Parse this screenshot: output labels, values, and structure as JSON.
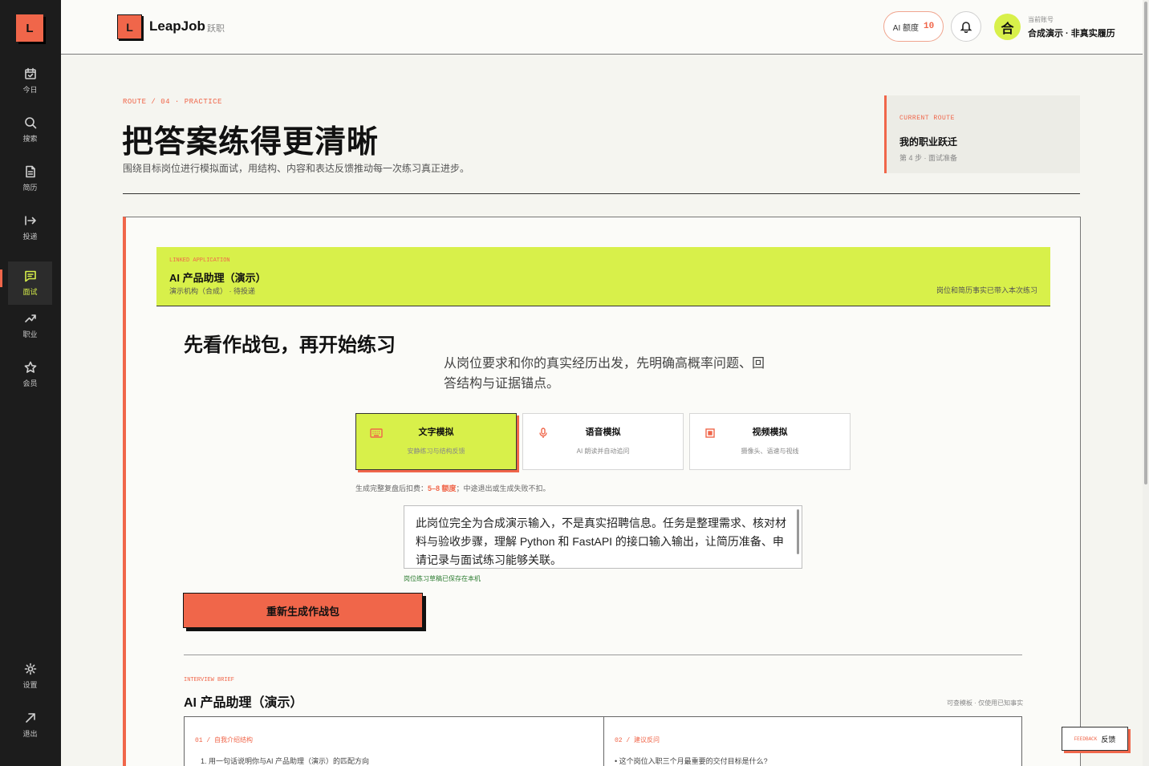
{
  "sidebar": {
    "logo": "L",
    "items": [
      {
        "label": "今日",
        "icon": "calendar-check-icon"
      },
      {
        "label": "搜索",
        "icon": "search-icon"
      },
      {
        "label": "简历",
        "icon": "document-icon"
      },
      {
        "label": "投递",
        "icon": "arrow-right-icon"
      },
      {
        "label": "面试",
        "icon": "chat-icon",
        "active": true
      },
      {
        "label": "职业",
        "icon": "trend-up-icon"
      },
      {
        "label": "会员",
        "icon": "star-icon"
      },
      {
        "label": "设置",
        "icon": "gear-icon"
      },
      {
        "label": "退出",
        "icon": "exit-arrow-icon"
      }
    ]
  },
  "topbar": {
    "brand_logo": "L",
    "brand_name": "LeapJob",
    "brand_tag": "跃职",
    "ai_quota_label": "AI 额度",
    "ai_quota_value": "10",
    "avatar_char": "合",
    "account_label": "当前账号",
    "account_name": "合成演示 · 非真实履历"
  },
  "header": {
    "route": "ROUTE / 04 · PRACTICE",
    "title": "把答案练得更清晰",
    "subtitle": "围绕目标岗位进行模拟面试，用结构、内容和表达反馈推动每一次练习真正进步。",
    "route_card": {
      "label": "CURRENT ROUTE",
      "title": "我的职业跃迁",
      "step": "第 4 步 · 面试准备"
    }
  },
  "linked": {
    "label": "LINKED APPLICATION",
    "title": "AI 产品助理（演示）",
    "subtitle": "演示机构（合成） · 待投递",
    "note": "岗位和简历事实已带入本次练习"
  },
  "prep": {
    "title": "先看作战包，再开始练习",
    "desc": "从岗位要求和你的真实经历出发，先明确高概率问题、回答结构与证据锚点。",
    "modes": [
      {
        "name": "文字模拟",
        "desc": "安静练习与结构反馈",
        "icon": "keyboard-icon",
        "active": true
      },
      {
        "name": "语音模拟",
        "desc": "AI 朗读并自动追问",
        "icon": "microphone-icon",
        "active": false
      },
      {
        "name": "视频模拟",
        "desc": "摄像头、语速与视线",
        "icon": "camera-icon",
        "active": false
      }
    ],
    "cost_prefix": "生成完整复盘后扣费：",
    "cost_value": "5–8 额度",
    "cost_suffix": "；中途退出或生成失败不扣。",
    "jd_text": "此岗位完全为合成演示输入，不是真实招聘信息。任务是整理需求、核对材料与验收步骤，理解 Python 和 FastAPI 的接口输入输出，让简历准备、申请记录与面试练习能够关联。",
    "jd_saved": "岗位练习草稿已保存在本机",
    "regen_button": "重新生成作战包"
  },
  "brief": {
    "label": "INTERVIEW BRIEF",
    "title": "AI 产品助理（演示）",
    "note": "可查模板 · 仅使用已知事实",
    "col1_head": "01 / 自我介绍结构",
    "col1_item": "1. 用一句话说明你与AI 产品助理（演示）的匹配方向",
    "col2_head": "02 / 建议反问",
    "col2_item": "•  这个岗位入职三个月最重要的交付目标是什么?"
  },
  "feedback": {
    "en": "FEEDBACK",
    "zh": "反馈"
  },
  "colors": {
    "accent": "#f0664a",
    "lime": "#d8f04a",
    "sidebar": "#1c1c1c"
  }
}
